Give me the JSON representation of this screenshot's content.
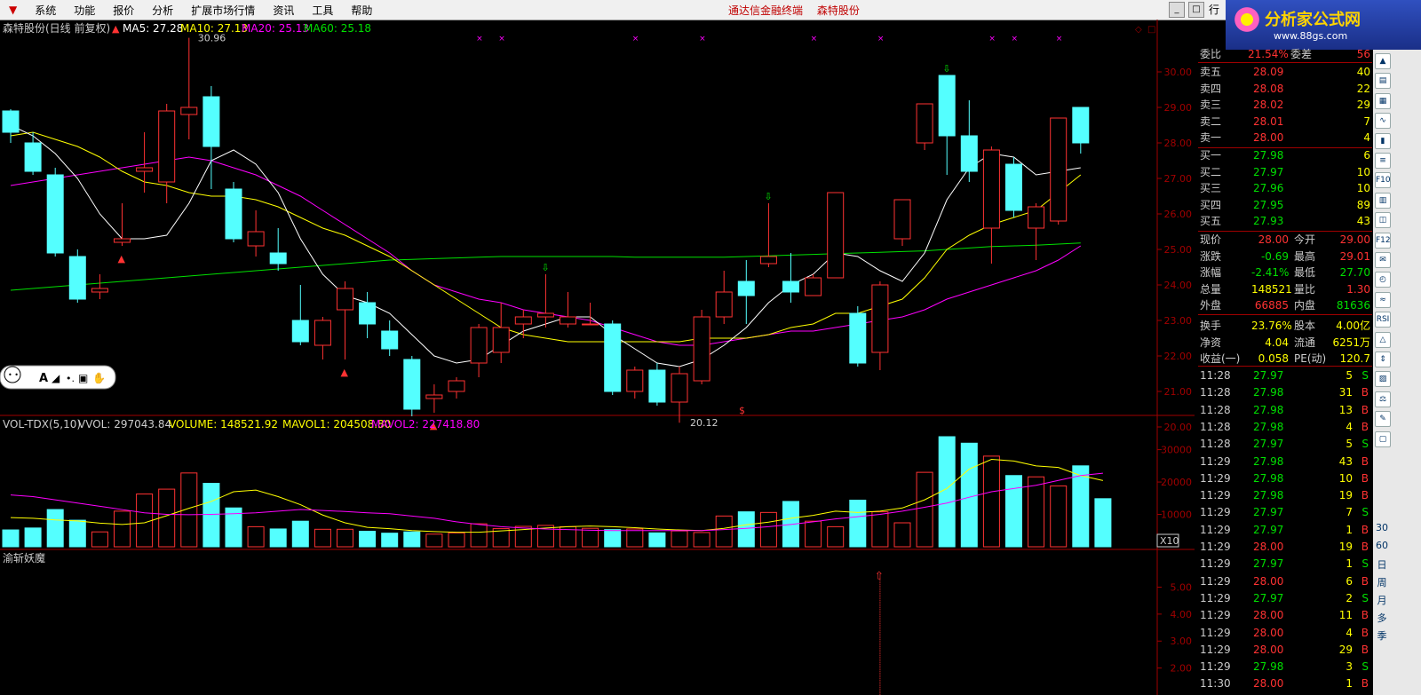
{
  "menu": {
    "items": [
      "系统",
      "功能",
      "报价",
      "分析",
      "扩展市场行情",
      "资讯",
      "工具",
      "帮助"
    ],
    "center_title": "通达信金融终端",
    "center_stock": "森特股份",
    "right_tab": "行"
  },
  "logo": {
    "title": "分析家公式网",
    "url": "www.88gs.com"
  },
  "main": {
    "title": "森特股份(日线 前复权)",
    "ma5_label": "MA5: 27.28",
    "ma10_label": "MA10: 27.13",
    "ma20_label": "MA20: 25.13",
    "ma60_label": "MA60: 25.18",
    "high_label": "30.96",
    "low_label": "20.12",
    "dollar_mark": "$",
    "price_ticks": [
      "30.00",
      "29.00",
      "28.00",
      "27.00",
      "26.00",
      "25.00",
      "24.00",
      "23.00",
      "22.00",
      "21.00",
      "20.00"
    ]
  },
  "vol": {
    "title": "VOL-TDX(5,10)",
    "vvol": "VVOL: 297043.84",
    "volume": "VOLUME: 148521.92",
    "mavol1": "MAVOL1: 204508.80",
    "mavol2": "MAVOL2: 227418.80",
    "ticks": [
      "30000",
      "20000",
      "10000"
    ],
    "unit": "X10"
  },
  "ind": {
    "title": "渝斩妖魔",
    "ticks": [
      "5.00",
      "4.00",
      "3.00",
      "2.00"
    ]
  },
  "colors": {
    "up": "#ff3232",
    "down": "#54ffff",
    "ma5": "#ffffff",
    "ma10": "#ffff00",
    "ma20": "#ff00ff",
    "ma60": "#00e000"
  },
  "chart_data": {
    "type": "candlestick",
    "price_range": [
      19.85,
      30.9
    ],
    "candles": [
      {
        "o": 28.9,
        "c": 28.3,
        "h": 28.95,
        "l": 28.0
      },
      {
        "o": 28.0,
        "c": 27.2,
        "h": 28.3,
        "l": 27.1
      },
      {
        "o": 27.1,
        "c": 24.9,
        "h": 27.3,
        "l": 24.8
      },
      {
        "o": 24.8,
        "c": 23.6,
        "h": 25.0,
        "l": 23.5
      },
      {
        "o": 23.8,
        "c": 23.9,
        "h": 24.3,
        "l": 23.6
      },
      {
        "o": 25.2,
        "c": 25.3,
        "h": 26.3,
        "l": 25.1
      },
      {
        "o": 27.2,
        "c": 27.3,
        "h": 28.3,
        "l": 26.6
      },
      {
        "o": 26.9,
        "c": 28.9,
        "h": 29.1,
        "l": 26.3
      },
      {
        "o": 28.8,
        "c": 29.0,
        "h": 30.96,
        "l": 28.1
      },
      {
        "o": 29.3,
        "c": 27.9,
        "h": 29.6,
        "l": 26.7
      },
      {
        "o": 26.7,
        "c": 25.3,
        "h": 26.9,
        "l": 25.2
      },
      {
        "o": 25.1,
        "c": 25.5,
        "h": 26.1,
        "l": 24.8
      },
      {
        "o": 24.9,
        "c": 24.6,
        "h": 25.6,
        "l": 24.4
      },
      {
        "o": 23.0,
        "c": 22.4,
        "h": 24.0,
        "l": 22.3
      },
      {
        "o": 22.3,
        "c": 23.0,
        "h": 23.1,
        "l": 21.9
      },
      {
        "o": 23.3,
        "c": 23.9,
        "h": 24.1,
        "l": 21.9
      },
      {
        "o": 23.5,
        "c": 22.9,
        "h": 23.8,
        "l": 22.5
      },
      {
        "o": 22.7,
        "c": 22.2,
        "h": 23.0,
        "l": 22.0
      },
      {
        "o": 21.9,
        "c": 20.5,
        "h": 22.0,
        "l": 20.3
      },
      {
        "o": 20.8,
        "c": 20.9,
        "h": 21.2,
        "l": 20.4
      },
      {
        "o": 21.0,
        "c": 21.3,
        "h": 21.4,
        "l": 20.8
      },
      {
        "o": 21.8,
        "c": 22.8,
        "h": 22.9,
        "l": 21.4
      },
      {
        "o": 22.1,
        "c": 22.8,
        "h": 23.5,
        "l": 21.8
      },
      {
        "o": 22.9,
        "c": 23.1,
        "h": 23.3,
        "l": 22.5
      },
      {
        "o": 23.1,
        "c": 23.2,
        "h": 24.3,
        "l": 22.8
      },
      {
        "o": 22.9,
        "c": 23.1,
        "h": 23.8,
        "l": 22.8
      },
      {
        "o": 22.9,
        "c": 22.9,
        "h": 23.5,
        "l": 22.9
      },
      {
        "o": 22.9,
        "c": 21.0,
        "h": 23.0,
        "l": 20.9
      },
      {
        "o": 21.0,
        "c": 21.6,
        "h": 21.7,
        "l": 20.8
      },
      {
        "o": 21.6,
        "c": 20.7,
        "h": 21.8,
        "l": 20.6
      },
      {
        "o": 20.7,
        "c": 21.5,
        "h": 21.7,
        "l": 20.12
      },
      {
        "o": 21.3,
        "c": 23.1,
        "h": 23.3,
        "l": 21.2
      },
      {
        "o": 23.1,
        "c": 23.8,
        "h": 24.4,
        "l": 22.9
      },
      {
        "o": 24.1,
        "c": 23.7,
        "h": 24.7,
        "l": 22.9
      },
      {
        "o": 24.6,
        "c": 24.8,
        "h": 26.3,
        "l": 24.5
      },
      {
        "o": 24.1,
        "c": 23.8,
        "h": 24.9,
        "l": 23.5
      },
      {
        "o": 23.7,
        "c": 24.2,
        "h": 24.3,
        "l": 23.7
      },
      {
        "o": 24.2,
        "c": 26.6,
        "h": 26.6,
        "l": 24.2
      },
      {
        "o": 23.2,
        "c": 21.8,
        "h": 23.4,
        "l": 21.7
      },
      {
        "o": 22.1,
        "c": 24.0,
        "h": 24.1,
        "l": 21.6
      },
      {
        "o": 25.3,
        "c": 26.4,
        "h": 26.4,
        "l": 25.1
      },
      {
        "o": 28.0,
        "c": 29.1,
        "h": 29.1,
        "l": 27.8
      },
      {
        "o": 29.9,
        "c": 28.2,
        "h": 29.9,
        "l": 27.1
      },
      {
        "o": 28.2,
        "c": 27.2,
        "h": 29.2,
        "l": 26.9
      },
      {
        "o": 25.6,
        "c": 27.8,
        "h": 27.9,
        "l": 24.6
      },
      {
        "o": 27.4,
        "c": 26.1,
        "h": 27.6,
        "l": 25.9
      },
      {
        "o": 25.6,
        "c": 26.2,
        "h": 26.3,
        "l": 24.7
      },
      {
        "o": 25.8,
        "c": 28.7,
        "h": 28.7,
        "l": 25.7
      },
      {
        "o": 29.0,
        "c": 28.0,
        "h": 29.01,
        "l": 27.7
      }
    ],
    "ma5": [
      28.5,
      28.2,
      27.7,
      27.0,
      26.0,
      25.3,
      25.3,
      25.4,
      26.3,
      27.5,
      27.8,
      27.4,
      26.6,
      25.3,
      24.3,
      23.7,
      23.5,
      23.2,
      22.6,
      22.0,
      21.8,
      21.9,
      22.3,
      22.7,
      22.9,
      23.1,
      23.1,
      22.6,
      22.2,
      21.8,
      21.7,
      21.9,
      22.3,
      22.8,
      23.5,
      24.0,
      24.3,
      24.9,
      24.8,
      24.4,
      24.1,
      24.9,
      26.4,
      27.3,
      27.7,
      27.6,
      27.1,
      27.2,
      27.3
    ],
    "ma10": [
      28.2,
      28.3,
      28.1,
      27.9,
      27.6,
      27.2,
      26.9,
      26.8,
      26.6,
      26.5,
      26.5,
      26.4,
      26.2,
      25.9,
      25.6,
      25.4,
      25.1,
      24.8,
      24.4,
      24.0,
      23.6,
      23.2,
      22.8,
      22.6,
      22.5,
      22.4,
      22.4,
      22.4,
      22.4,
      22.4,
      22.4,
      22.5,
      22.5,
      22.5,
      22.6,
      22.8,
      22.9,
      23.2,
      23.2,
      23.4,
      23.6,
      24.2,
      25.0,
      25.4,
      25.7,
      25.9,
      26.1,
      26.6,
      27.1
    ],
    "ma20": [
      26.8,
      26.9,
      27.0,
      27.1,
      27.2,
      27.3,
      27.4,
      27.5,
      27.6,
      27.5,
      27.3,
      27.1,
      26.8,
      26.5,
      26.1,
      25.7,
      25.3,
      24.9,
      24.4,
      24.0,
      23.8,
      23.6,
      23.5,
      23.3,
      23.2,
      23.1,
      23.0,
      22.8,
      22.6,
      22.4,
      22.3,
      22.3,
      22.4,
      22.5,
      22.6,
      22.7,
      22.7,
      22.8,
      22.9,
      23.0,
      23.1,
      23.3,
      23.6,
      23.8,
      24.0,
      24.2,
      24.4,
      24.7,
      25.1
    ],
    "ma60": [
      23.85,
      23.9,
      23.95,
      24.0,
      24.05,
      24.1,
      24.15,
      24.2,
      24.25,
      24.3,
      24.35,
      24.4,
      24.45,
      24.5,
      24.55,
      24.6,
      24.65,
      24.7,
      24.72,
      24.74,
      24.76,
      24.78,
      24.8,
      24.8,
      24.8,
      24.8,
      24.8,
      24.8,
      24.78,
      24.78,
      24.78,
      24.78,
      24.78,
      24.8,
      24.82,
      24.84,
      24.86,
      24.88,
      24.9,
      24.92,
      24.94,
      24.96,
      25.0,
      25.04,
      25.08,
      25.1,
      25.12,
      25.15,
      25.18
    ],
    "vol_range": [
      0,
      34000
    ],
    "volumes": [
      5200,
      5800,
      11500,
      8200,
      4600,
      11000,
      16300,
      17800,
      22800,
      19600,
      12000,
      6200,
      5500,
      7900,
      5400,
      5400,
      4800,
      4200,
      4600,
      3900,
      4300,
      7100,
      5600,
      6300,
      6600,
      6200,
      5700,
      5300,
      5500,
      4300,
      4900,
      4400,
      9500,
      10800,
      10600,
      14000,
      7900,
      6200,
      14400,
      10800,
      7400,
      23000,
      34000,
      32000,
      28000,
      22000,
      21600,
      18800,
      25000,
      14852
    ],
    "mavol1": [
      9000,
      8800,
      8300,
      8000,
      7300,
      6900,
      7400,
      9600,
      11900,
      14000,
      17000,
      17500,
      15500,
      13000,
      9800,
      7400,
      6000,
      5600,
      5000,
      4700,
      4500,
      4500,
      4900,
      5300,
      5800,
      6200,
      6400,
      6200,
      5900,
      5500,
      5200,
      5000,
      5700,
      6800,
      7600,
      8800,
      9700,
      11000,
      10600,
      11000,
      12000,
      14500,
      18000,
      24000,
      27000,
      26500,
      25000,
      24500,
      22000,
      20450
    ],
    "mavol2": [
      16000,
      15500,
      14500,
      13500,
      12500,
      11500,
      10500,
      10000,
      9900,
      10000,
      10200,
      10500,
      11000,
      11500,
      11200,
      10900,
      10500,
      10200,
      9500,
      8800,
      7700,
      6900,
      6200,
      5800,
      5500,
      5300,
      5100,
      5000,
      5000,
      5000,
      5000,
      5000,
      5300,
      5700,
      6200,
      6900,
      7700,
      8600,
      9300,
      10000,
      11000,
      12200,
      13500,
      15300,
      17000,
      18000,
      19000,
      20500,
      22000,
      22740
    ],
    "ind_range": [
      1.0,
      6.3
    ],
    "ind_signal_index": 39,
    "ind_signal_value": 5.5
  },
  "quote": {
    "weibi_label": "委比",
    "weibi": "21.54%",
    "weicha_label": "委差",
    "weicha": "56",
    "asks": [
      {
        "label": "卖五",
        "price": "28.09",
        "vol": "40"
      },
      {
        "label": "卖四",
        "price": "28.08",
        "vol": "22"
      },
      {
        "label": "卖三",
        "price": "28.02",
        "vol": "29"
      },
      {
        "label": "卖二",
        "price": "28.01",
        "vol": "7"
      },
      {
        "label": "卖一",
        "price": "28.00",
        "vol": "4"
      }
    ],
    "bids": [
      {
        "label": "买一",
        "price": "27.98",
        "vol": "6"
      },
      {
        "label": "买二",
        "price": "27.97",
        "vol": "10"
      },
      {
        "label": "买三",
        "price": "27.96",
        "vol": "10"
      },
      {
        "label": "买四",
        "price": "27.95",
        "vol": "89"
      },
      {
        "label": "买五",
        "price": "27.93",
        "vol": "43"
      }
    ],
    "stats": [
      {
        "l1": "现价",
        "v1": "28.00",
        "c1": "#ff3232",
        "l2": "今开",
        "v2": "29.00",
        "c2": "#ff3232"
      },
      {
        "l1": "涨跌",
        "v1": "-0.69",
        "c1": "#00e000",
        "l2": "最高",
        "v2": "29.01",
        "c2": "#ff3232"
      },
      {
        "l1": "涨幅",
        "v1": "-2.41%",
        "c1": "#00e000",
        "l2": "最低",
        "v2": "27.70",
        "c2": "#00e000"
      },
      {
        "l1": "总量",
        "v1": "148521",
        "c1": "#ffff00",
        "l2": "量比",
        "v2": "1.30",
        "c2": "#ff3232"
      },
      {
        "l1": "外盘",
        "v1": "66885",
        "c1": "#ff3232",
        "l2": "内盘",
        "v2": "81636",
        "c2": "#00e000"
      },
      {
        "l1": "换手",
        "v1": "23.76%",
        "c1": "#ffff00",
        "l2": "股本",
        "v2": "4.00亿",
        "c2": "#ffff00"
      },
      {
        "l1": "净资",
        "v1": "4.04",
        "c1": "#ffff00",
        "l2": "流通",
        "v2": "6251万",
        "c2": "#ffff00"
      },
      {
        "l1": "收益(一)",
        "v1": "0.058",
        "c1": "#ffff00",
        "l2": "PE(动)",
        "v2": "120.7",
        "c2": "#ffff00"
      }
    ],
    "ticks": [
      {
        "t": "11:28",
        "p": "27.97",
        "v": "5",
        "s": "S"
      },
      {
        "t": "11:28",
        "p": "27.98",
        "v": "31",
        "s": "B"
      },
      {
        "t": "11:28",
        "p": "27.98",
        "v": "13",
        "s": "B"
      },
      {
        "t": "11:28",
        "p": "27.98",
        "v": "4",
        "s": "B"
      },
      {
        "t": "11:28",
        "p": "27.97",
        "v": "5",
        "s": "S"
      },
      {
        "t": "11:29",
        "p": "27.98",
        "v": "43",
        "s": "B"
      },
      {
        "t": "11:29",
        "p": "27.98",
        "v": "10",
        "s": "B"
      },
      {
        "t": "11:29",
        "p": "27.98",
        "v": "19",
        "s": "B"
      },
      {
        "t": "11:29",
        "p": "27.97",
        "v": "7",
        "s": "S"
      },
      {
        "t": "11:29",
        "p": "27.97",
        "v": "1",
        "s": "B"
      },
      {
        "t": "11:29",
        "p": "28.00",
        "v": "19",
        "s": "B"
      },
      {
        "t": "11:29",
        "p": "27.97",
        "v": "1",
        "s": "S"
      },
      {
        "t": "11:29",
        "p": "28.00",
        "v": "6",
        "s": "B"
      },
      {
        "t": "11:29",
        "p": "27.97",
        "v": "2",
        "s": "S"
      },
      {
        "t": "11:29",
        "p": "28.00",
        "v": "11",
        "s": "B"
      },
      {
        "t": "11:29",
        "p": "28.00",
        "v": "4",
        "s": "B"
      },
      {
        "t": "11:29",
        "p": "28.00",
        "v": "29",
        "s": "B"
      },
      {
        "t": "11:29",
        "p": "27.98",
        "v": "3",
        "s": "S"
      },
      {
        "t": "11:30",
        "p": "28.00",
        "v": "1",
        "s": "B"
      }
    ]
  },
  "toolbar": {
    "labels": [
      "30",
      "60",
      "日",
      "周",
      "月",
      "多",
      "季"
    ]
  }
}
